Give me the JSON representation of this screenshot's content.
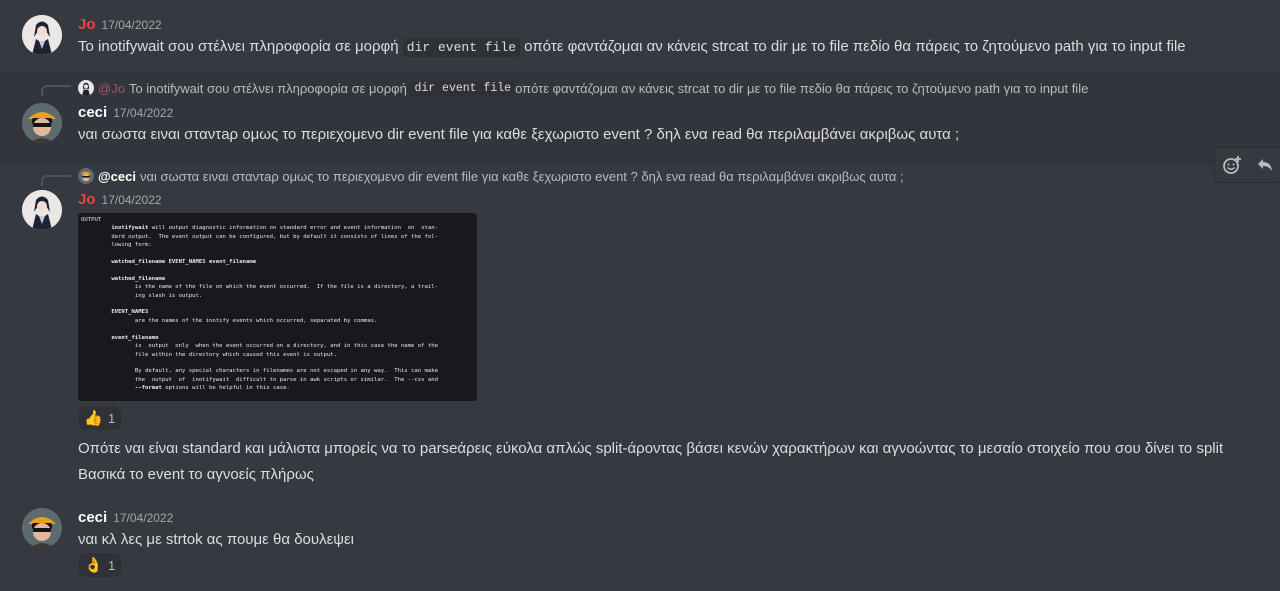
{
  "messages": {
    "m1": {
      "author": "Jo",
      "timestamp": "17/04/2022",
      "text_before": "Το inotifywait σου στέλνει πληροφορία σε μορφή ",
      "code": "dir event file",
      "text_after": " οπότε φαντάζομαι αν κάνεις strcat το dir με το file πεδίο θα πάρεις το ζητούμενο path για το input file"
    },
    "m2": {
      "reply_mention": "@Jo",
      "reply_before": "Το inotifywait σου στέλνει πληροφορία σε μορφή ",
      "reply_code": "dir event file",
      "reply_after": " οπότε φαντάζομαι αν κάνεις strcat το dir με το file πεδίο θα πάρεις το ζητούμενο path για το input file",
      "author": "ceci",
      "timestamp": "17/04/2022",
      "text": "ναι σωστα ειναι σταντaρ ομως το περιεχομενο dir event file για καθε ξεχωριστο event ? δηλ ενα read θα περιλαμβάνει  ακριβως αυτα ;"
    },
    "m3": {
      "reply_mention": "@ceci",
      "reply_text": "ναι σωστα ειναι σταντaρ ομως το περιεχομενο dir event file για καθε ξεχωριστο event ? δηλ ενα read θα περιλαμβάνει  ακριβως αυτα ;",
      "author": "Jo",
      "timestamp": "17/04/2022",
      "reaction": {
        "emoji": "👍",
        "icon": "thumbs-up-icon",
        "count": "1"
      },
      "followup1": "Οπότε ναι είναι standard και μάλιστα μπορείς να το parseάρεις εύκολα απλώς split-άροντας βάσει κενών χαρακτήρων και αγνοώντας το μεσαίο στοιχείο που σου δίνει το split",
      "followup2": "Βασικά το event το αγνοείς πλήρως"
    },
    "m4": {
      "author": "ceci",
      "timestamp": "17/04/2022",
      "text": "ναι κλ λες με strtok ας πουμε θα δουλεψει",
      "reaction": {
        "emoji": "👌",
        "icon": "ok-hand-icon",
        "count": "1"
      }
    }
  },
  "attachment": {
    "heading": "OUTPUT",
    "l1a": "inotifywait",
    "l1b": " will output diagnostic information on standard error and event information  on  stan-",
    "l2": "dard output.  The event output can be configured, but by default it consists of lines of the fol-",
    "l3": "lowing form:",
    "l4": "watched_filename EVENT_NAMES event_filename",
    "l5": "watched_filename",
    "l6": "is the name of the file on which the event occurred.  If the file is a directory, a trail-",
    "l7": "ing slash is output.",
    "l8": "EVENT_NAMES",
    "l9": "are the names of the inotify events which occurred, separated by commas.",
    "l10": "event_filename",
    "l11": "is  output  only  when the event occurred on a directory, and in this case the name of the",
    "l12": "file within the directory which caused this event is output.",
    "l13": "By default, any special characters in filenames are not escaped in any way.  This can make",
    "l14": "the  output  of  inotifywait  difficult to parse in awk scripts or similar.  The --csv and",
    "l15a": "--format",
    "l15b": " options will be helpful in this case."
  },
  "toolbar": {
    "add_reaction_icon": "add-reaction-icon",
    "reply_icon": "reply-icon"
  },
  "colors": {
    "background": "#36393f",
    "jo_name": "#ed4245",
    "ceci_name": "#ffffff",
    "hover": "#32353b"
  }
}
